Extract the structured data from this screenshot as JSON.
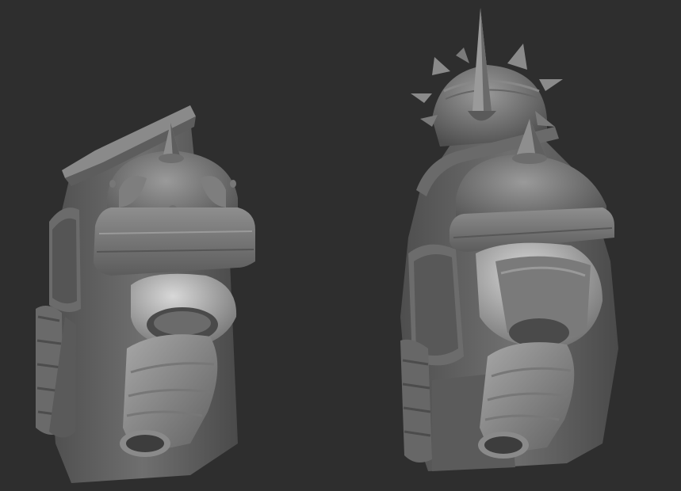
{
  "scene": {
    "background_color": "#2e2e2e",
    "material_light": "#a9a9a9",
    "material_mid": "#7c7c7c",
    "material_dark": "#4a4a4a",
    "material_shadow": "#353535",
    "subjects": [
      {
        "name": "armor-sculpt-left-view"
      },
      {
        "name": "armor-sculpt-right-view"
      }
    ]
  }
}
